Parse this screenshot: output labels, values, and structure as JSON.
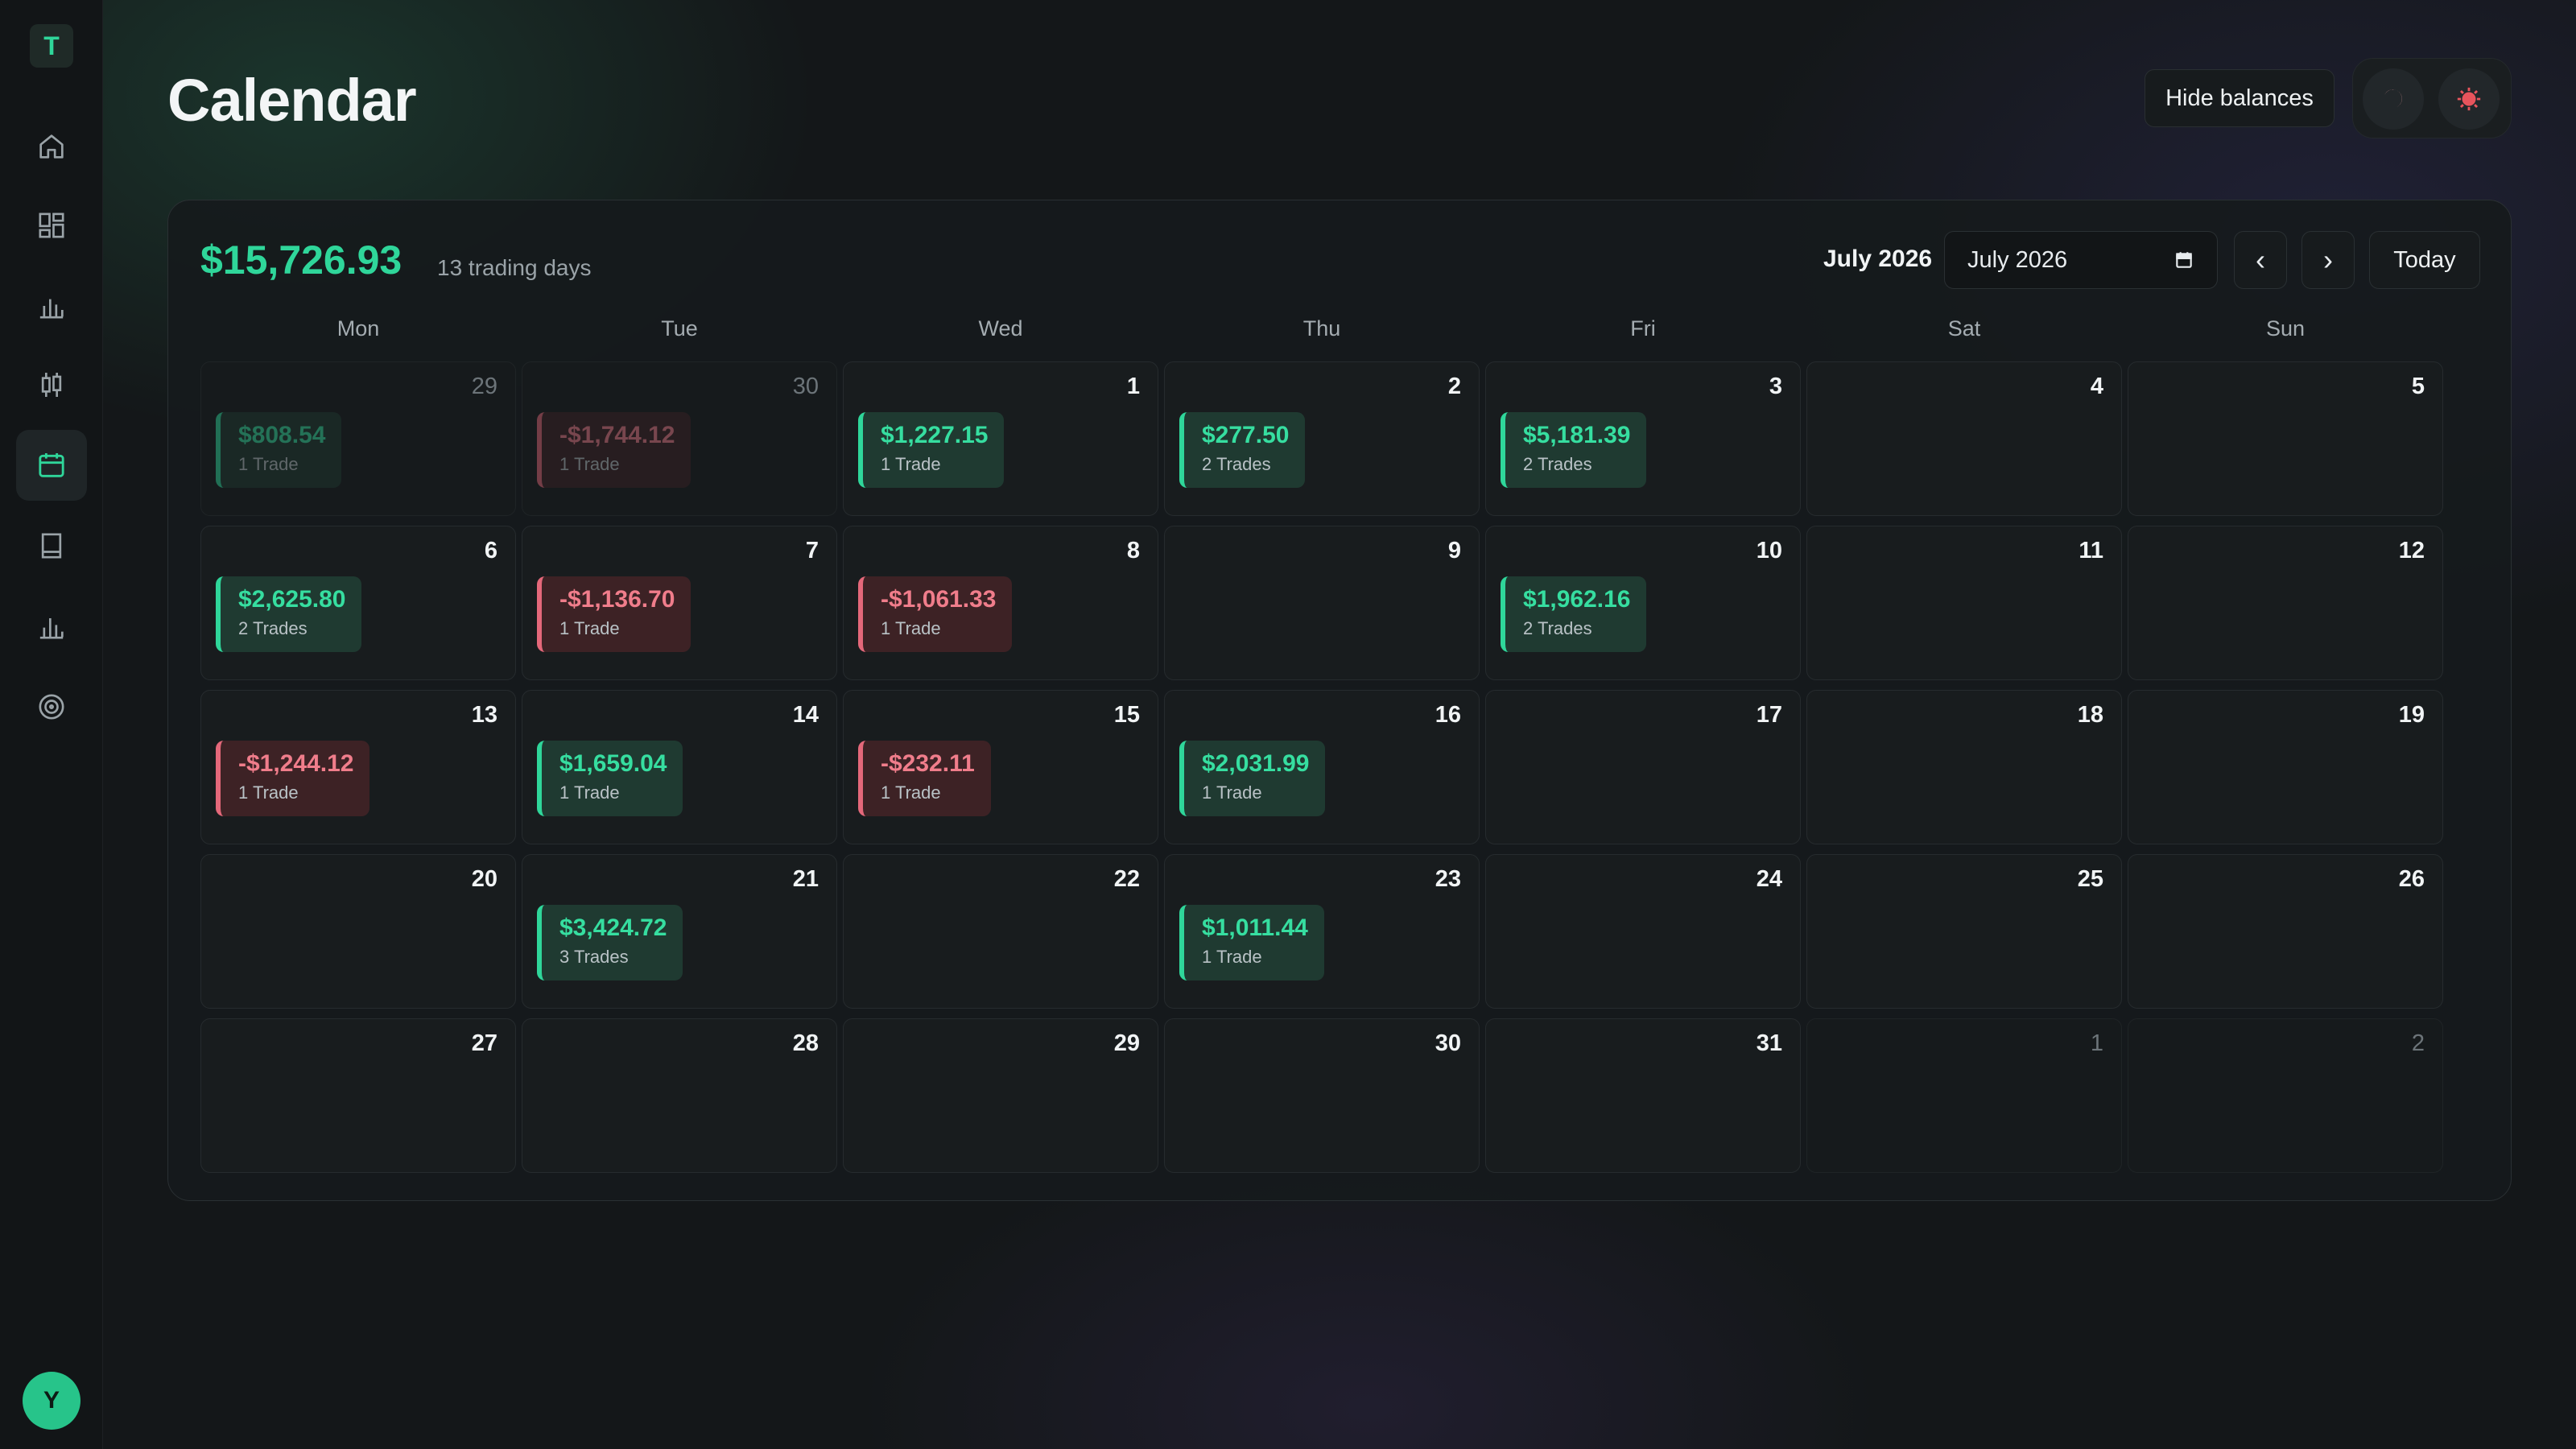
{
  "sidebar": {
    "logo_letter": "T",
    "items": [
      {
        "icon": "home-icon"
      },
      {
        "icon": "dashboard-icon"
      },
      {
        "icon": "bar-chart-icon"
      },
      {
        "icon": "candlestick-icon"
      },
      {
        "icon": "calendar-icon",
        "active": true
      },
      {
        "icon": "journal-icon"
      },
      {
        "icon": "reports-icon"
      },
      {
        "icon": "target-icon"
      }
    ],
    "avatar_initial": "Y"
  },
  "header": {
    "title": "Calendar",
    "hide_balances_label": "Hide balances",
    "theme_buttons": [
      "moon-icon",
      "sun-icon"
    ]
  },
  "calendar": {
    "total_pnl": "$15,726.93",
    "trading_days": "13 trading days",
    "month_label": "July 2026",
    "month_input_value": "July 2026",
    "prev_label": "‹",
    "next_label": "›",
    "today_label": "Today",
    "weekdays": [
      "Mon",
      "Tue",
      "Wed",
      "Thu",
      "Fri",
      "Sat",
      "Sun"
    ],
    "colors": {
      "positive": "#2fd69a",
      "negative": "#e4687a"
    },
    "weeks": [
      [
        {
          "day": "29",
          "outside": true,
          "amount": "$808.54",
          "trades": "1 Trade",
          "sign": "pos"
        },
        {
          "day": "30",
          "outside": true,
          "amount": "-$1,744.12",
          "trades": "1 Trade",
          "sign": "neg"
        },
        {
          "day": "1",
          "amount": "$1,227.15",
          "trades": "1 Trade",
          "sign": "pos"
        },
        {
          "day": "2",
          "amount": "$277.50",
          "trades": "2 Trades",
          "sign": "pos"
        },
        {
          "day": "3",
          "amount": "$5,181.39",
          "trades": "2 Trades",
          "sign": "pos"
        },
        {
          "day": "4"
        },
        {
          "day": "5"
        }
      ],
      [
        {
          "day": "6",
          "amount": "$2,625.80",
          "trades": "2 Trades",
          "sign": "pos"
        },
        {
          "day": "7",
          "amount": "-$1,136.70",
          "trades": "1 Trade",
          "sign": "neg"
        },
        {
          "day": "8",
          "amount": "-$1,061.33",
          "trades": "1 Trade",
          "sign": "neg"
        },
        {
          "day": "9"
        },
        {
          "day": "10",
          "amount": "$1,962.16",
          "trades": "2 Trades",
          "sign": "pos"
        },
        {
          "day": "11"
        },
        {
          "day": "12"
        }
      ],
      [
        {
          "day": "13",
          "amount": "-$1,244.12",
          "trades": "1 Trade",
          "sign": "neg"
        },
        {
          "day": "14",
          "amount": "$1,659.04",
          "trades": "1 Trade",
          "sign": "pos"
        },
        {
          "day": "15",
          "amount": "-$232.11",
          "trades": "1 Trade",
          "sign": "neg"
        },
        {
          "day": "16",
          "amount": "$2,031.99",
          "trades": "1 Trade",
          "sign": "pos"
        },
        {
          "day": "17"
        },
        {
          "day": "18"
        },
        {
          "day": "19"
        }
      ],
      [
        {
          "day": "20"
        },
        {
          "day": "21",
          "amount": "$3,424.72",
          "trades": "3 Trades",
          "sign": "pos"
        },
        {
          "day": "22"
        },
        {
          "day": "23",
          "amount": "$1,011.44",
          "trades": "1 Trade",
          "sign": "pos"
        },
        {
          "day": "24"
        },
        {
          "day": "25"
        },
        {
          "day": "26"
        }
      ],
      [
        {
          "day": "27"
        },
        {
          "day": "28"
        },
        {
          "day": "29"
        },
        {
          "day": "30"
        },
        {
          "day": "31"
        },
        {
          "day": "1",
          "outside": true
        },
        {
          "day": "2",
          "outside": true
        }
      ]
    ]
  }
}
